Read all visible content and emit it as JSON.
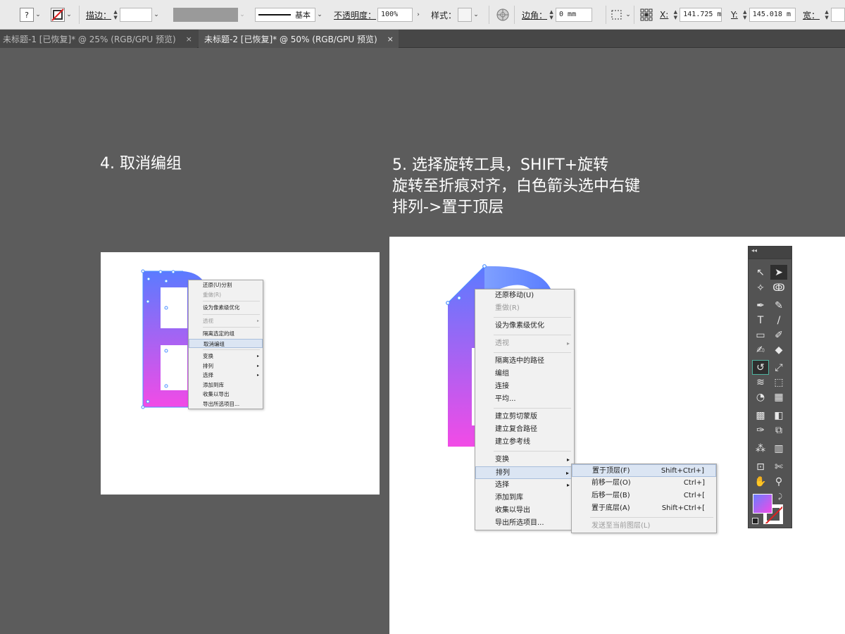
{
  "controlbar": {
    "fill_question": "?",
    "stroke_label": "描边：",
    "brush_name": "基本",
    "opacity_label": "不透明度：",
    "opacity_value": "100%",
    "style_label": "样式：",
    "corner_label": "边角：",
    "corner_value": "0 mm",
    "x_label": "X:",
    "x_value": "141.725 m",
    "y_label": "Y:",
    "y_value": "145.018 m",
    "w_label": "宽："
  },
  "tabs": [
    {
      "label": "未标题-1 [已恢复]* @ 25% (RGB/GPU 预览)",
      "close": "×"
    },
    {
      "label": "未标题-2 [已恢复]* @ 50% (RGB/GPU 预览)",
      "close": "×"
    }
  ],
  "captions": {
    "step4": "4. 取消编组",
    "step5_line1": "5. 选择旋转工具，SHIFT+旋转",
    "step5_line2": "旋转至折痕对齐，白色箭头选中右键",
    "step5_line3": "排列->置于顶层"
  },
  "menu_small": [
    {
      "label": "还原(U)分割",
      "disabled": false
    },
    {
      "label": "重做(R)",
      "disabled": true
    },
    {
      "sep": true
    },
    {
      "label": "设为像素级优化",
      "disabled": false
    },
    {
      "sep": true
    },
    {
      "label": "透视",
      "disabled": true,
      "arrow": "▸"
    },
    {
      "sep": true
    },
    {
      "label": "隔离选定的组",
      "disabled": false
    },
    {
      "label": "取消编组",
      "disabled": false,
      "highlight": true
    },
    {
      "sep": true
    },
    {
      "label": "变换",
      "disabled": false,
      "arrow": "▸"
    },
    {
      "label": "排列",
      "disabled": false,
      "arrow": "▸"
    },
    {
      "label": "选择",
      "disabled": false,
      "arrow": "▸"
    },
    {
      "label": "添加到库",
      "disabled": false
    },
    {
      "label": "收集以导出",
      "disabled": false
    },
    {
      "label": "导出所选项目...",
      "disabled": false
    }
  ],
  "menu_big": [
    {
      "label": "还原移动(U)",
      "disabled": false
    },
    {
      "label": "重做(R)",
      "disabled": true
    },
    {
      "sep": true
    },
    {
      "label": "设为像素级优化",
      "disabled": false
    },
    {
      "sep": true
    },
    {
      "label": "透视",
      "disabled": true,
      "arrow": "▸"
    },
    {
      "sep": true
    },
    {
      "label": "隔离选中的路径",
      "disabled": false
    },
    {
      "label": "编组",
      "disabled": false
    },
    {
      "label": "连接",
      "disabled": false
    },
    {
      "label": "平均...",
      "disabled": false
    },
    {
      "sep": true
    },
    {
      "label": "建立剪切蒙版",
      "disabled": false
    },
    {
      "label": "建立复合路径",
      "disabled": false
    },
    {
      "label": "建立参考线",
      "disabled": false
    },
    {
      "sep": true
    },
    {
      "label": "变换",
      "disabled": false,
      "arrow": "▸"
    },
    {
      "label": "排列",
      "disabled": false,
      "arrow": "▸",
      "highlight": true
    },
    {
      "label": "选择",
      "disabled": false,
      "arrow": "▸"
    },
    {
      "label": "添加到库",
      "disabled": false
    },
    {
      "label": "收集以导出",
      "disabled": false
    },
    {
      "label": "导出所选项目...",
      "disabled": false
    }
  ],
  "submenu": [
    {
      "label": "置于顶层(F)",
      "shortcut": "Shift+Ctrl+]",
      "highlight": true
    },
    {
      "label": "前移一层(O)",
      "shortcut": "Ctrl+]"
    },
    {
      "label": "后移一层(B)",
      "shortcut": "Ctrl+["
    },
    {
      "label": "置于底层(A)",
      "shortcut": "Shift+Ctrl+["
    },
    {
      "sep": true
    },
    {
      "label": "发送至当前图层(L)",
      "shortcut": "",
      "disabled": true
    }
  ],
  "tools_panel": {
    "grip": "◂◂",
    "tools": [
      {
        "name": "selection-tool-icon",
        "glyph": "↖"
      },
      {
        "name": "direct-selection-tool-icon",
        "glyph": "➤",
        "state": "on"
      },
      {
        "name": "magic-wand-tool-icon",
        "glyph": "✧"
      },
      {
        "name": "lasso-tool-icon",
        "glyph": "ↂ"
      },
      {
        "name": "pen-tool-icon",
        "glyph": "✒"
      },
      {
        "name": "curvature-tool-icon",
        "glyph": "✎"
      },
      {
        "name": "type-tool-icon",
        "glyph": "T"
      },
      {
        "name": "line-tool-icon",
        "glyph": "/"
      },
      {
        "name": "rectangle-tool-icon",
        "glyph": "▭"
      },
      {
        "name": "paintbrush-tool-icon",
        "glyph": "✐"
      },
      {
        "name": "shaper-tool-icon",
        "glyph": "✍"
      },
      {
        "name": "eraser-tool-icon",
        "glyph": "◆"
      },
      {
        "name": "rotate-tool-icon",
        "glyph": "↺",
        "state": "sel"
      },
      {
        "name": "scale-tool-icon",
        "glyph": "⤢"
      },
      {
        "name": "width-tool-icon",
        "glyph": "≋"
      },
      {
        "name": "free-transform-tool-icon",
        "glyph": "⬚"
      },
      {
        "name": "shape-builder-tool-icon",
        "glyph": "◔"
      },
      {
        "name": "perspective-grid-tool-icon",
        "glyph": "▦"
      },
      {
        "name": "mesh-tool-icon",
        "glyph": "▩"
      },
      {
        "name": "gradient-tool-icon",
        "glyph": "◧"
      },
      {
        "name": "eyedropper-tool-icon",
        "glyph": "✑"
      },
      {
        "name": "blend-tool-icon",
        "glyph": "⧉"
      },
      {
        "name": "symbol-sprayer-tool-icon",
        "glyph": "⁂"
      },
      {
        "name": "column-graph-tool-icon",
        "glyph": "▥"
      },
      {
        "name": "artboard-tool-icon",
        "glyph": "⊡"
      },
      {
        "name": "slice-tool-icon",
        "glyph": "✄"
      },
      {
        "name": "hand-tool-icon",
        "glyph": "✋"
      },
      {
        "name": "zoom-tool-icon",
        "glyph": "⚲"
      }
    ]
  },
  "colors": {
    "gradient_top": "#5b7bff",
    "gradient_bottom": "#f24be6",
    "canvas_bg": "#5c5c5c",
    "accent_selection": "#4a90ff"
  }
}
